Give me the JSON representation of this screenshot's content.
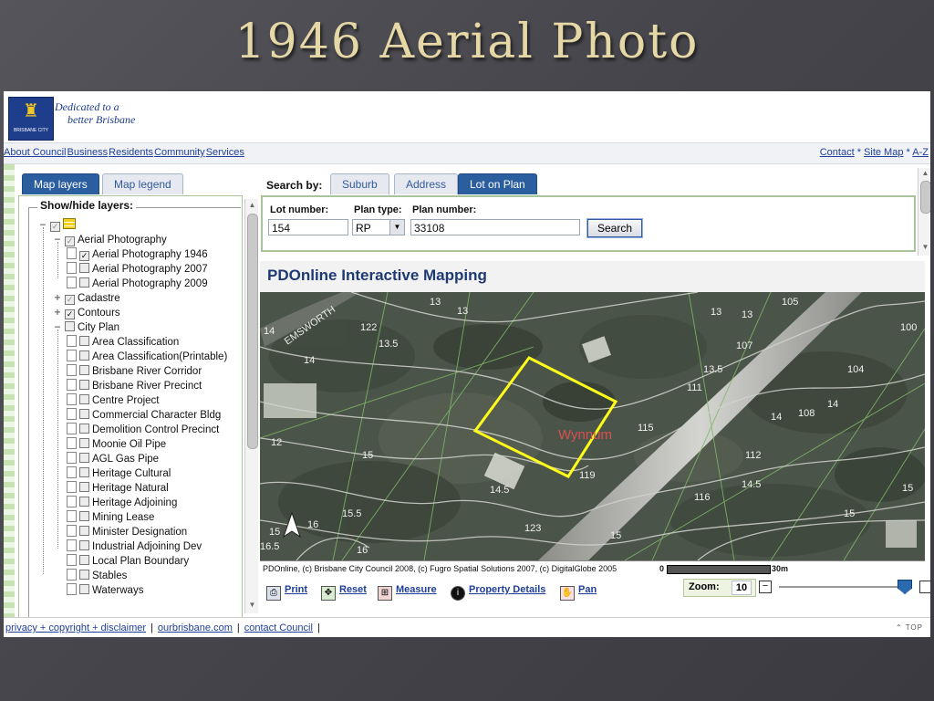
{
  "slide_title": "1946 Aerial Photo",
  "header": {
    "tagline_line1": "Dedicated to a",
    "tagline_line2": "better Brisbane",
    "logo_caption": "BRISBANE CITY"
  },
  "nav": {
    "items": [
      "About Council",
      "Business",
      "Residents",
      "Community",
      "Services"
    ],
    "right": {
      "contact": "Contact",
      "sep1": " * ",
      "sitemap": "Site Map",
      "sep2": " * ",
      "az": "A-Z"
    }
  },
  "left_tabs": [
    "Map layers",
    "Map legend"
  ],
  "layers": {
    "legend": "Show/hide layers:",
    "items": [
      {
        "label": "",
        "checked": true,
        "gray": true,
        "kind": "root"
      },
      {
        "label": "Aerial Photography",
        "checked": true,
        "gray": true,
        "kind": "group-open"
      },
      {
        "label": "Aerial Photography 1946",
        "checked": true,
        "kind": "leaf"
      },
      {
        "label": "Aerial Photography 2007",
        "checked": false,
        "kind": "leaf"
      },
      {
        "label": "Aerial Photography 2009",
        "checked": false,
        "kind": "leaf"
      },
      {
        "label": "Cadastre",
        "checked": true,
        "gray": true,
        "kind": "group-closed"
      },
      {
        "label": "Contours",
        "checked": true,
        "kind": "group-closed"
      },
      {
        "label": "City Plan",
        "checked": false,
        "kind": "group-open"
      },
      {
        "label": "Area Classification",
        "checked": false,
        "kind": "leaf"
      },
      {
        "label": "Area Classification(Printable)",
        "checked": false,
        "kind": "leaf"
      },
      {
        "label": "Brisbane River Corridor",
        "checked": false,
        "kind": "leaf"
      },
      {
        "label": "Brisbane River Precinct",
        "checked": false,
        "kind": "leaf"
      },
      {
        "label": "Centre Project",
        "checked": false,
        "kind": "leaf"
      },
      {
        "label": "Commercial Character Bldg",
        "checked": false,
        "kind": "leaf"
      },
      {
        "label": "Demolition Control Precinct",
        "checked": false,
        "kind": "leaf"
      },
      {
        "label": "Moonie Oil Pipe",
        "checked": false,
        "kind": "leaf"
      },
      {
        "label": "AGL Gas Pipe",
        "checked": false,
        "kind": "leaf"
      },
      {
        "label": "Heritage Cultural",
        "checked": false,
        "kind": "leaf"
      },
      {
        "label": "Heritage Natural",
        "checked": false,
        "kind": "leaf"
      },
      {
        "label": "Heritage Adjoining",
        "checked": false,
        "kind": "leaf"
      },
      {
        "label": "Mining Lease",
        "checked": false,
        "kind": "leaf"
      },
      {
        "label": "Minister Designation",
        "checked": false,
        "kind": "leaf"
      },
      {
        "label": "Industrial Adjoining Dev",
        "checked": false,
        "kind": "leaf"
      },
      {
        "label": "Local Plan Boundary",
        "checked": false,
        "kind": "leaf"
      },
      {
        "label": "Stables",
        "checked": false,
        "kind": "leaf"
      },
      {
        "label": "Waterways",
        "checked": false,
        "kind": "leaf"
      }
    ]
  },
  "search": {
    "label": "Search by:",
    "tabs": [
      "Suburb",
      "Address",
      "Lot on Plan"
    ],
    "lot_label": "Lot number:",
    "lot_value": "154",
    "plantype_label": "Plan type:",
    "plantype_value": "RP",
    "plannum_label": "Plan number:",
    "plannum_value": "33108",
    "button": "Search"
  },
  "map": {
    "title": "PDOnline Interactive Mapping",
    "suburb_label": "Wynnum",
    "street_label": "EMSWORTH",
    "copyright": "PDOnline, (c) Brisbane City Council 2008, (c) Fugro Spatial Solutions 2007, (c) DigitalGlobe 2005",
    "scale_start": "0",
    "scale_end": "30m",
    "labels": [
      "13",
      "13",
      "14",
      "122",
      "13.5",
      "14",
      "105",
      "13",
      "13",
      "107",
      "100",
      "111",
      "13.5",
      "104",
      "14",
      "108",
      "14",
      "115",
      "12",
      "15",
      "112",
      "119",
      "14.5",
      "116",
      "14.5",
      "15",
      "15.5",
      "16",
      "123",
      "15",
      "16",
      "16.5",
      "15",
      "15"
    ]
  },
  "tools": {
    "print": "Print",
    "reset": "Reset",
    "measure": "Measure",
    "property": "Property Details",
    "pan": "Pan",
    "zoom_label": "Zoom:",
    "zoom_value": "10"
  },
  "footer": {
    "privacy": "privacy + copyright + disclaimer",
    "ourbrisbane": "ourbrisbane.com",
    "contact": "contact Council",
    "top": "TOP"
  }
}
